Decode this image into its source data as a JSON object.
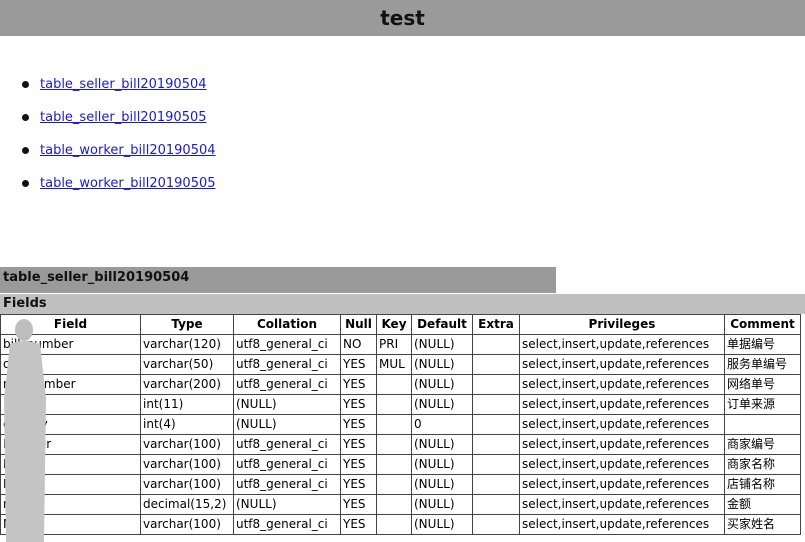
{
  "header": {
    "title": "test"
  },
  "tables_list": [
    "table_seller_bill20190504",
    "table_seller_bill20190505",
    "table_worker_bill20190504",
    "table_worker_bill20190505"
  ],
  "section": {
    "table_name": "table_seller_bill20190504",
    "fields_label": "Fields"
  },
  "columns": [
    "Field",
    "Type",
    "Collation",
    "Null",
    "Key",
    "Default",
    "Extra",
    "Privileges",
    "Comment"
  ],
  "rows": [
    [
      "bill_number",
      "varchar(120)",
      "utf8_general_ci",
      "NO",
      "PRI",
      "(NULL)",
      "",
      "select,insert,update,references",
      "单据编号"
    ],
    [
      "order",
      "varchar(50)",
      "utf8_general_ci",
      "YES",
      "MUL",
      "(NULL)",
      "",
      "select,insert,update,references",
      "服务单编号"
    ],
    [
      "net_number",
      "varchar(200)",
      "utf8_general_ci",
      "YES",
      "",
      "(NULL)",
      "",
      "select,insert,update,references",
      "网络单号"
    ],
    [
      "",
      "int(11)",
      "(NULL)",
      "YES",
      "",
      "(NULL)",
      "",
      "select,insert,update,references",
      "订单来源"
    ],
    [
      "directly",
      "int(4)",
      "(NULL)",
      "YES",
      "",
      "0",
      "",
      "select,insert,update,references",
      ""
    ],
    [
      "Number",
      "varchar(100)",
      "utf8_general_ci",
      "YES",
      "",
      "(NULL)",
      "",
      "select,insert,update,references",
      "商家编号"
    ],
    [
      "Name",
      "varchar(100)",
      "utf8_general_ci",
      "YES",
      "",
      "(NULL)",
      "",
      "select,insert,update,references",
      "商家名称"
    ],
    [
      "Name",
      "varchar(100)",
      "utf8_general_ci",
      "YES",
      "",
      "(NULL)",
      "",
      "select,insert,update,references",
      "店铺名称"
    ],
    [
      "nt",
      "decimal(15,2)",
      "(NULL)",
      "YES",
      "",
      "(NULL)",
      "",
      "select,insert,update,references",
      "金额"
    ],
    [
      "Name",
      "varchar(100)",
      "utf8_general_ci",
      "YES",
      "",
      "(NULL)",
      "",
      "select,insert,update,references",
      "买家姓名"
    ]
  ]
}
